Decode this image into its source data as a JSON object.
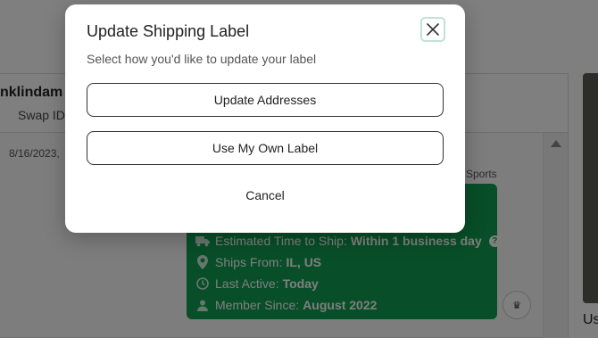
{
  "background": {
    "user_name": "nklindam a",
    "swap_id_label": "Swap ID:",
    "message_date": "8/16/2023,",
    "category": "Sports",
    "seller_info": [
      {
        "icon": "truck-icon",
        "label": "Estimated Time to Ship:",
        "value": "Within 1 business day",
        "help": "?"
      },
      {
        "icon": "location-pin-icon",
        "label": "Ships From:",
        "value": "IL, US"
      },
      {
        "icon": "clock-icon",
        "label": "Last Active:",
        "value": "Today"
      },
      {
        "icon": "person-icon",
        "label": "Member Since:",
        "value": "August 2022"
      }
    ],
    "side_text": "Us"
  },
  "modal": {
    "title": "Update Shipping Label",
    "subtitle": "Select how you'd like to update your label",
    "update_addresses_label": "Update Addresses",
    "own_label_label": "Use My Own Label",
    "cancel_label": "Cancel",
    "close_icon": "close-icon"
  },
  "colors": {
    "accent_green": "#119c50",
    "close_focus_ring": "#bfe3d6"
  }
}
